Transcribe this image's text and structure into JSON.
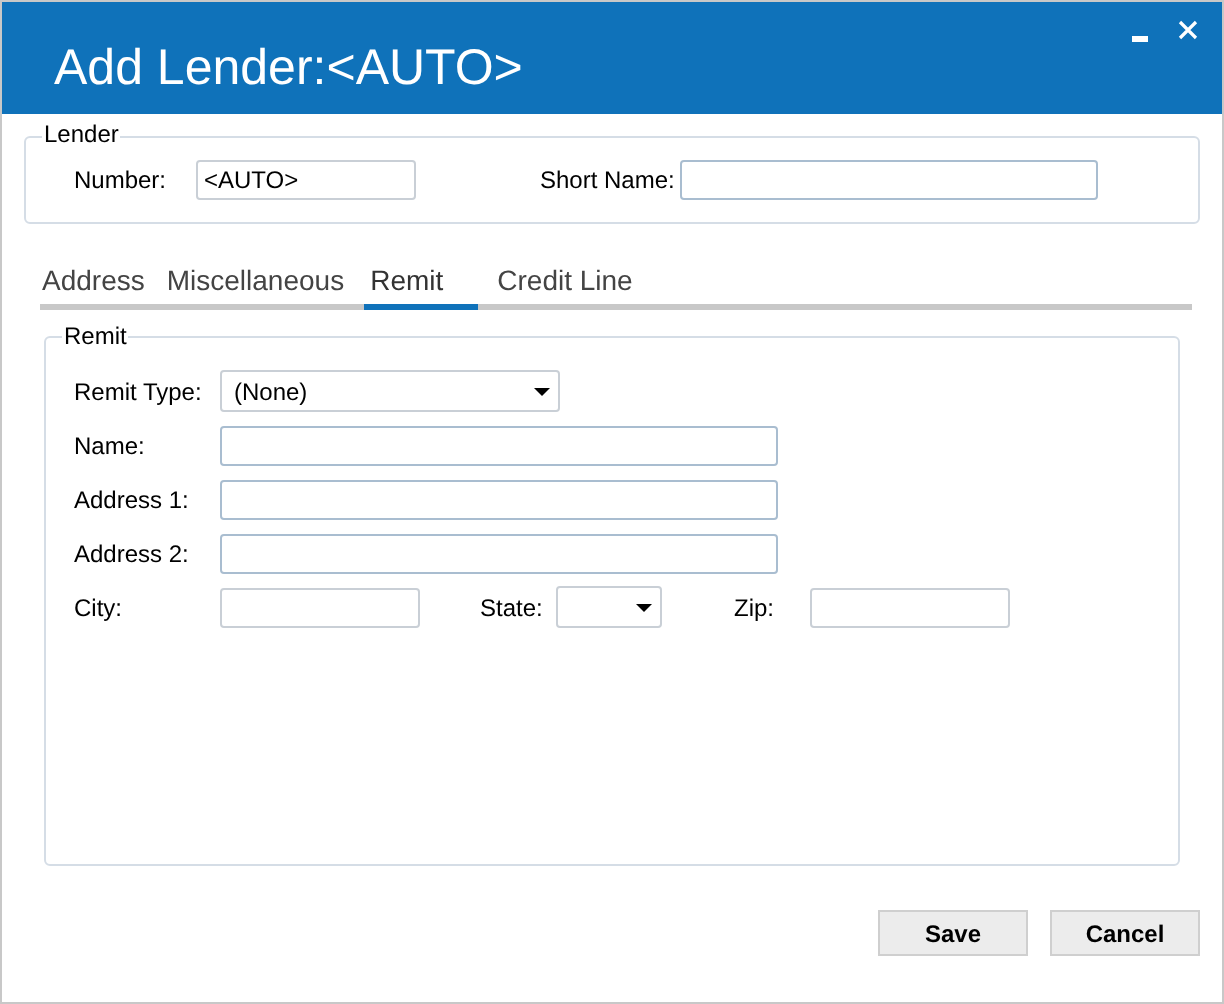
{
  "window": {
    "title": "Add Lender:<AUTO>"
  },
  "lender": {
    "legend": "Lender",
    "number": {
      "label": "Number:",
      "value": "<AUTO>"
    },
    "short_name": {
      "label": "Short Name:"
    }
  },
  "tabs": [
    {
      "label": "Address",
      "selected": false
    },
    {
      "label": "Miscellaneous",
      "selected": false
    },
    {
      "label": "Remit",
      "selected": true
    },
    {
      "label": "Credit Line",
      "selected": false
    }
  ],
  "remit": {
    "legend": "Remit",
    "rows": [
      [
        {
          "label": "Remit Type:",
          "kind": "dropdown",
          "value": "(None)"
        }
      ],
      [
        {
          "label": "Name:",
          "kind": "text"
        }
      ],
      [
        {
          "label": "Address 1:",
          "kind": "text"
        }
      ],
      [
        {
          "label": "Address 2:",
          "kind": "text"
        }
      ],
      [
        {
          "label": "City:",
          "kind": "short"
        },
        {
          "label": "State:",
          "kind": "small-dropdown"
        },
        {
          "label": "Zip:",
          "kind": "short"
        }
      ]
    ]
  },
  "buttons": [
    {
      "label": "Save"
    },
    {
      "label": "Cancel"
    }
  ]
}
